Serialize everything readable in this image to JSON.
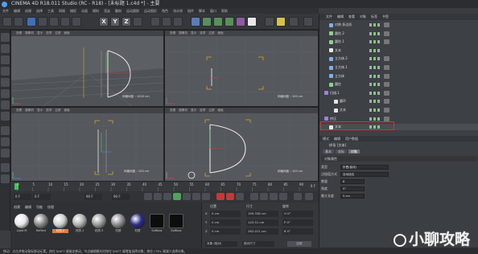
{
  "title": "CINEMA 4D R18.011 Studio (RC - R18) - [未标题 1.c4d *] - 主要",
  "menu": [
    "文件",
    "编辑",
    "创建",
    "选择",
    "工具",
    "网格",
    "捕捉",
    "动画",
    "模拟",
    "渲染",
    "雕刻",
    "运动跟踪",
    "运动图形",
    "角色",
    "流水线",
    "插件",
    "脚本",
    "窗口",
    "帮助"
  ],
  "toolbar_axes": [
    "X",
    "Y",
    "Z"
  ],
  "viewport_menu": [
    "查看",
    "摄像机",
    "显示",
    "选项",
    "过滤",
    "面板"
  ],
  "viewports": [
    {
      "label": "透视视图",
      "footer": "网格间距 : 1000 cm"
    },
    {
      "label": "顶视图",
      "footer": "网格间距 : 100 cm"
    },
    {
      "label": "右视图",
      "footer": "网格间距 : 100 cm"
    },
    {
      "label": "正视图",
      "footer": "网格间距 : 100 cm"
    }
  ],
  "timeline": {
    "ticks": [
      "0",
      "5",
      "10",
      "15",
      "20",
      "25",
      "30",
      "35",
      "40",
      "45",
      "50",
      "55",
      "60",
      "65",
      "70",
      "75",
      "80",
      "85",
      "90"
    ],
    "end": "0 F"
  },
  "transport": {
    "start": "0 F",
    "current": "0 F",
    "end": "90 F",
    "end2": "90 F"
  },
  "material_menu": [
    "创建",
    "编辑",
    "功能",
    "纹理"
  ],
  "materials": [
    {
      "label": "Light M",
      "color": "#e8e8e8"
    },
    {
      "label": "Reflect",
      "color": "#888"
    },
    {
      "label": "材质.2",
      "color": "#cfcfcf",
      "selected": true
    },
    {
      "label": "材质.1",
      "color": "#b0b0b0"
    },
    {
      "label": "材质.3",
      "color": "#9a9a9a"
    },
    {
      "label": "材质",
      "color": "#8c8c8c"
    },
    {
      "label": "材质",
      "color": "#2d2d8a"
    },
    {
      "label": "Softbox",
      "color": "#111"
    },
    {
      "label": "Softbox",
      "color": "#1a1a1a"
    }
  ],
  "coords": {
    "headers": [
      "位置",
      "尺寸",
      "旋转"
    ],
    "rows": [
      {
        "axis": "X",
        "pos": "0 cm",
        "size": "199.338 cm",
        "rot": "H 0°"
      },
      {
        "axis": "Y",
        "pos": "0 cm",
        "size": "143.51 cm",
        "rot": "P 0°"
      },
      {
        "axis": "Z",
        "pos": "0 cm",
        "size": "262.011 cm",
        "rot": "B 0°"
      }
    ],
    "mode": "对象 (相对)",
    "sizemode": "绝对尺寸",
    "apply": "应用"
  },
  "objmgr": {
    "menu": [
      "文件",
      "编辑",
      "查看",
      "对象",
      "标签",
      "书签"
    ],
    "items": [
      {
        "label": "对称.多边形",
        "indent": 1
      },
      {
        "label": "圆柱.2",
        "indent": 1
      },
      {
        "label": "圆柱.1",
        "indent": 1
      },
      {
        "label": "文本",
        "indent": 1
      },
      {
        "label": "立方体.2",
        "indent": 1
      },
      {
        "label": "立方体.1",
        "indent": 1
      },
      {
        "label": "立方体",
        "indent": 1
      },
      {
        "label": "圆柱",
        "indent": 1
      },
      {
        "label": "扫描.1",
        "indent": 0
      },
      {
        "label": "圆环",
        "indent": 2
      },
      {
        "label": "文本",
        "indent": 2
      },
      {
        "label": "挤压",
        "indent": 0
      },
      {
        "label": "文本",
        "indent": 1,
        "highlight": true
      }
    ]
  },
  "attr": {
    "menu": [
      "模式",
      "编辑",
      "用户数据"
    ],
    "object": "样条 [文本]",
    "tabs": [
      "基本",
      "坐标",
      "对象"
    ],
    "section": "对象属性",
    "rows": [
      {
        "label": "类型",
        "value": "折叠(曲线)"
      },
      {
        "label": "点插值方式",
        "value": "自动适应"
      },
      {
        "label": "数量",
        "value": "8"
      },
      {
        "label": "角度",
        "value": "5°"
      },
      {
        "label": "最大长度",
        "value": "5 cm"
      }
    ]
  },
  "status": "移动：点击并拖动鼠标移动元素。按住 SHIFT 键量化移动；节点编辑模式时按住 SHIFT 键增加选择对象；按住 CTRL 键减少选择对象。",
  "watermark": "小聊攻略",
  "colors": {
    "selection": "#e07d3c",
    "highlight": "#d9342b",
    "spline": "#e6e6e6",
    "bracket": "#e0a030"
  }
}
